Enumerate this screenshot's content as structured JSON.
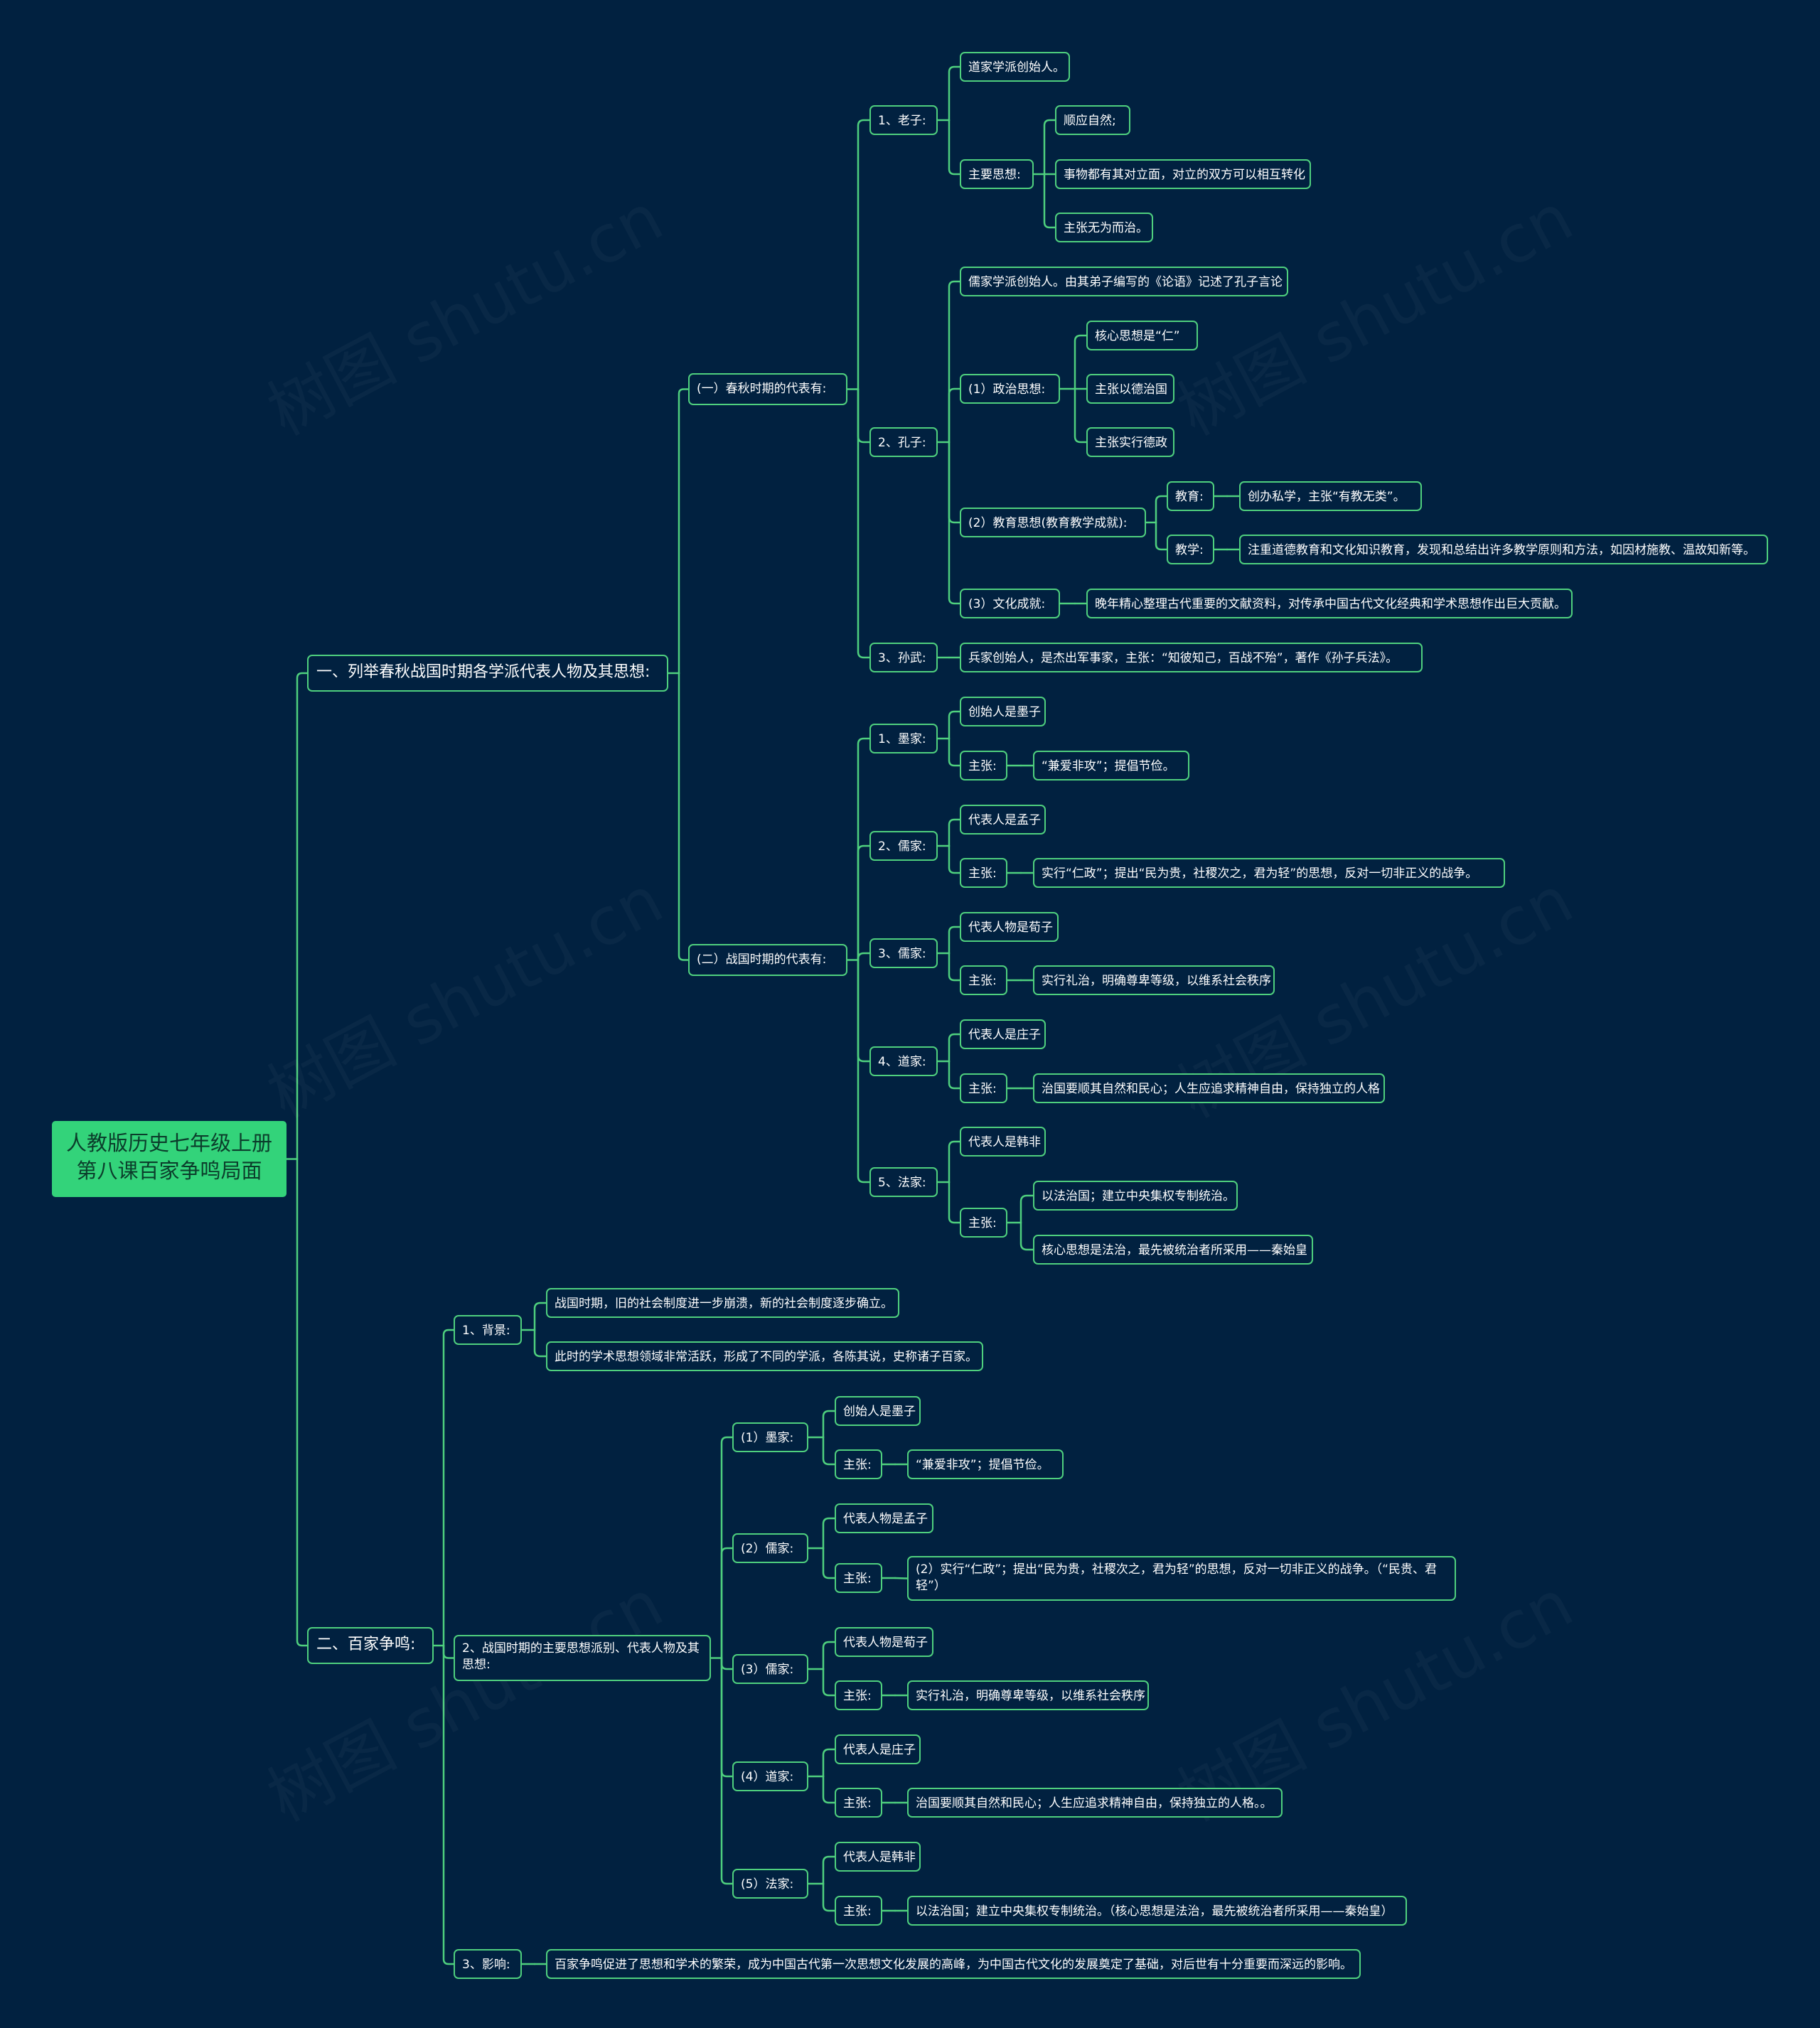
{
  "root": {
    "line1": "人教版历史七年级上册",
    "line2": "第八课百家争鸣局面"
  },
  "watermark": "树图 shutu.cn",
  "line_color": "#4fd07e",
  "root_color": "#33d37a",
  "background": "#012140",
  "nodes": {
    "s1": "一、列举春秋战国时期各学派代表人物及其思想:",
    "s1a": "(一）春秋时期的代表有:",
    "laozi": "1、老子:",
    "laozi_1": "道家学派创始人。",
    "laozi_2": "主要思想:",
    "laozi_2a": "顺应自然;",
    "laozi_2b": "事物都有其对立面，对立的双方可以相互转化",
    "laozi_2c": "主张无为而治。",
    "kongzi": "2、孔子:",
    "kongzi_1": "儒家学派创始人。由其弟子编写的《论语》记述了孔子言论",
    "kongzi_2": "(1）政治思想:",
    "kongzi_2a": "核心思想是“仁”",
    "kongzi_2b": "主张以德治国",
    "kongzi_2c": "主张实行德政",
    "kongzi_3": "(2）教育思想(教育教学成就):",
    "kongzi_3a": "教育:",
    "kongzi_3a1": "创办私学，主张“有教无类”。",
    "kongzi_3b": "教学:",
    "kongzi_3b1": "注重道德教育和文化知识教育，发现和总结出许多教学原则和方法，如因材施教、温故知新等。",
    "kongzi_4": "(3）文化成就:",
    "kongzi_4a": "晚年精心整理古代重要的文献资料，对传承中国古代文化经典和学术思想作出巨大贡献。",
    "sunwu": "3、孙武:",
    "sunwu_1": "兵家创始人，是杰出军事家，主张：“知彼知己，百战不殆”，著作《孙子兵法》。",
    "s1b": "(二）战国时期的代表有:",
    "mo": "1、墨家:",
    "mo_1": "创始人是墨子",
    "mo_2": "主张:",
    "mo_2a": "“兼爱非攻”；提倡节俭。",
    "ru1": "2、儒家:",
    "ru1_1": "代表人是孟子",
    "ru1_2": "主张:",
    "ru1_2a": "实行“仁政”；提出“民为贵，社稷次之，君为轻”的思想，反对一切非正义的战争。",
    "ru2": "3、儒家:",
    "ru2_1": "代表人物是荀子",
    "ru2_2": "主张:",
    "ru2_2a": "实行礼治，明确尊卑等级，以维系社会秩序",
    "dao": "4、道家:",
    "dao_1": "代表人是庄子",
    "dao_2": "主张:",
    "dao_2a": "治国要顺其自然和民心；人生应追求精神自由，保持独立的人格",
    "fa": "5、法家:",
    "fa_1": "代表人是韩非",
    "fa_2": "主张:",
    "fa_2a": "以法治国；建立中央集权专制统治。",
    "fa_2b": "核心思想是法治，最先被统治者所采用——秦始皇",
    "s2": "二、百家争鸣:",
    "bg": "1、背景:",
    "bg_1": "战国时期，旧的社会制度进一步崩溃，新的社会制度逐步确立。",
    "bg_2": "此时的学术思想领域非常活跃，形成了不同的学派，各陈其说，史称诸子百家。",
    "zy": "2、战国时期的主要思想派别、代表人物及其思想:",
    "p1": "(1）墨家:",
    "p1_1": "创始人是墨子",
    "p1_2": "主张:",
    "p1_2a": "“兼爱非攻”；提倡节俭。",
    "p2": "(2）儒家:",
    "p2_1": "代表人物是孟子",
    "p2_2": "主张:",
    "p2_2a": "(2）实行“仁政”；提出“民为贵，社稷次之，君为轻”的思想，反对一切非正义的战争。（“民贵、君轻”）",
    "p3": "(3）儒家:",
    "p3_1": "代表人物是荀子",
    "p3_2": "主张:",
    "p3_2a": "实行礼治，明确尊卑等级，以维系社会秩序",
    "p4": "(4）道家:",
    "p4_1": "代表人是庄子",
    "p4_2": "主张:",
    "p4_2a": "治国要顺其自然和民心；人生应追求精神自由，保持独立的人格。。",
    "p5": "(5）法家:",
    "p5_1": "代表人是韩非",
    "p5_2": "主张:",
    "p5_2a": "以法治国；建立中央集权专制统治。（核心思想是法治，最先被统治者所采用——秦始皇）",
    "yx": "3、影响:",
    "yx_1": "百家争鸣促进了思想和学术的繁荣，成为中国古代第一次思想文化发展的高峰，为中国古代文化的发展奠定了基础，对后世有十分重要而深远的影响。"
  }
}
